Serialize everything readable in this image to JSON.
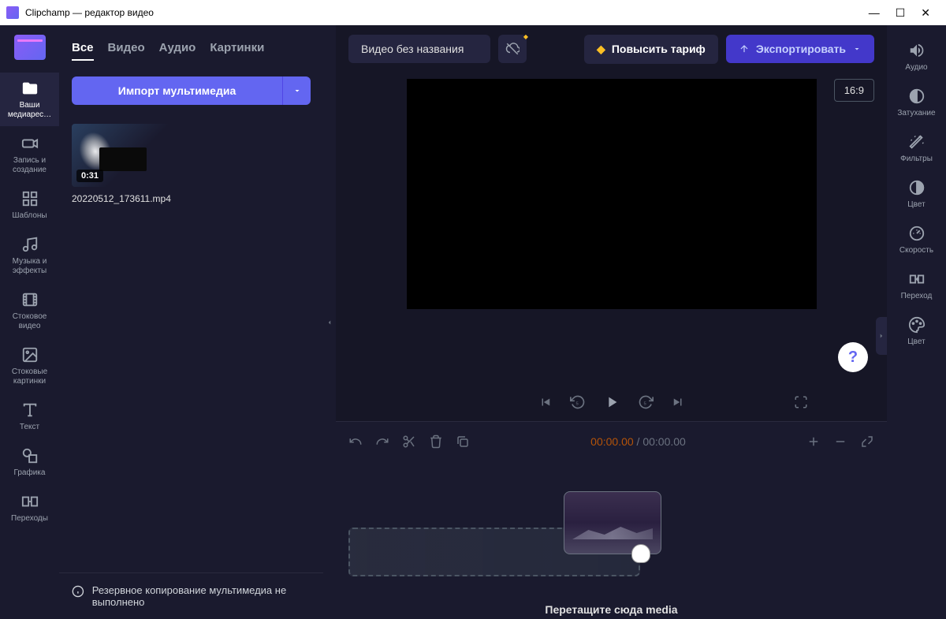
{
  "titlebar": {
    "title": "Clipchamp — редактор видео"
  },
  "leftNav": {
    "items": [
      {
        "label": "Ваши медиарес…"
      },
      {
        "label": "Запись и создание"
      },
      {
        "label": "Шаблоны"
      },
      {
        "label": "Музыка и эффекты"
      },
      {
        "label": "Стоковое видео"
      },
      {
        "label": "Стоковые картинки"
      },
      {
        "label": "Текст"
      },
      {
        "label": "Графика"
      },
      {
        "label": "Переходы"
      }
    ]
  },
  "mediaPanel": {
    "tabs": [
      {
        "label": "Все"
      },
      {
        "label": "Видео"
      },
      {
        "label": "Аудио"
      },
      {
        "label": "Картинки"
      }
    ],
    "importLabel": "Импорт мультимедиа",
    "items": [
      {
        "name": "20220512_173611.mp4",
        "duration": "0:31"
      }
    ]
  },
  "topBar": {
    "projectTitle": "Видео без названия",
    "upgradeLabel": "Повысить тариф",
    "exportLabel": "Экспортировать",
    "aspectRatio": "16:9"
  },
  "timeline": {
    "currentTime": "00:00.00",
    "totalTime": "00:00.00",
    "dropText": "Перетащите сюда media"
  },
  "backup": {
    "message": "Резервное копирование мультимедиа не выполнено"
  },
  "rightNav": {
    "items": [
      {
        "label": "Аудио"
      },
      {
        "label": "Затухание"
      },
      {
        "label": "Фильтры"
      },
      {
        "label": "Цвет"
      },
      {
        "label": "Скорость"
      },
      {
        "label": "Переход"
      },
      {
        "label": "Цвет"
      }
    ]
  }
}
